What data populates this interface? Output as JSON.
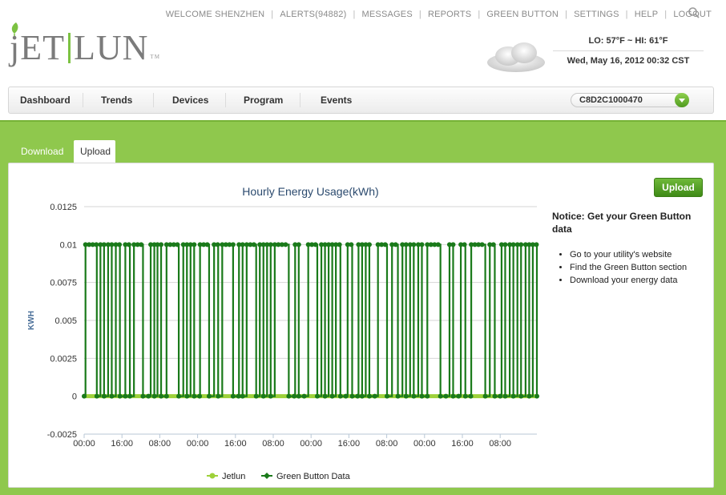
{
  "header": {
    "links": [
      "WELCOME SHENZHEN",
      "ALERTS(94882)",
      "MESSAGES",
      "REPORTS",
      "GREEN BUTTON",
      "SETTINGS",
      "HELP",
      "LOGOUT"
    ],
    "logo_text_left": "jET",
    "logo_text_right": "LUN",
    "logo_tm": "TM",
    "logo_icon": "leaf-icon"
  },
  "weather": {
    "temps": "LO: 57°F ~ HI: 61°F",
    "datetime": "Wed, May 16, 2012 00:32 CST",
    "icon": "cloud-icon"
  },
  "nav": {
    "items": [
      "Dashboard",
      "Trends",
      "Devices",
      "Program",
      "Events"
    ],
    "device_value": "C8D2C1000470",
    "search_icon": "search-icon"
  },
  "tabs": [
    "Download",
    "Upload"
  ],
  "upload_button": "Upload",
  "notice": {
    "title": "Notice: Get your Green Button data",
    "items": [
      "Go to your utility's website",
      "Find the Green Button section",
      "Download your energy data"
    ]
  },
  "colors": {
    "brand_green": "#7cc242",
    "band_green": "#8fc84d",
    "series_jetlun": "#9ed13a",
    "series_gb": "#1a7a1a"
  },
  "chart_data": {
    "type": "line",
    "title": "Hourly Energy Usage(kWh)",
    "ylabel": "KWH",
    "ylim": [
      -0.0025,
      0.0125
    ],
    "yticks": [
      "0.0125",
      "0.01",
      "0.0075",
      "0.005",
      "0.0025",
      "0",
      "-0.0025"
    ],
    "xticks": [
      "00:00",
      "16:00",
      "08:00",
      "00:00",
      "16:00",
      "08:00",
      "00:00",
      "16:00",
      "08:00",
      "00:00",
      "16:00",
      "08:00"
    ],
    "legend_placement": "bottom-center",
    "series": [
      {
        "name": "Jetlun",
        "constant_value": 0
      },
      {
        "name": "Green Button Data",
        "low": 0,
        "high": 0.01,
        "high_intervals": [
          [
            0.003,
            0.028
          ],
          [
            0.036,
            0.044
          ],
          [
            0.053,
            0.061
          ],
          [
            0.07,
            0.079
          ],
          [
            0.091,
            0.101
          ],
          [
            0.11,
            0.13
          ],
          [
            0.147,
            0.155
          ],
          [
            0.162,
            0.17
          ],
          [
            0.182,
            0.209
          ],
          [
            0.219,
            0.227
          ],
          [
            0.235,
            0.243
          ],
          [
            0.256,
            0.276
          ],
          [
            0.287,
            0.296
          ],
          [
            0.305,
            0.329
          ],
          [
            0.342,
            0.35
          ],
          [
            0.359,
            0.38
          ],
          [
            0.388,
            0.396
          ],
          [
            0.404,
            0.412
          ],
          [
            0.421,
            0.452
          ],
          [
            0.466,
            0.474
          ],
          [
            0.495,
            0.515
          ],
          [
            0.524,
            0.532
          ],
          [
            0.54,
            0.548
          ],
          [
            0.556,
            0.566
          ],
          [
            0.582,
            0.592
          ],
          [
            0.606,
            0.614
          ],
          [
            0.622,
            0.63
          ],
          [
            0.649,
            0.669
          ],
          [
            0.68,
            0.693
          ],
          [
            0.703,
            0.711
          ],
          [
            0.72,
            0.728
          ],
          [
            0.738,
            0.746
          ],
          [
            0.758,
            0.787
          ],
          [
            0.807,
            0.815
          ],
          [
            0.832,
            0.842
          ],
          [
            0.855,
            0.886
          ],
          [
            0.896,
            0.907
          ],
          [
            0.922,
            0.93
          ],
          [
            0.94,
            0.948
          ],
          [
            0.957,
            0.965
          ],
          [
            0.975,
            0.983
          ],
          [
            0.991,
            1.0
          ]
        ]
      }
    ]
  }
}
